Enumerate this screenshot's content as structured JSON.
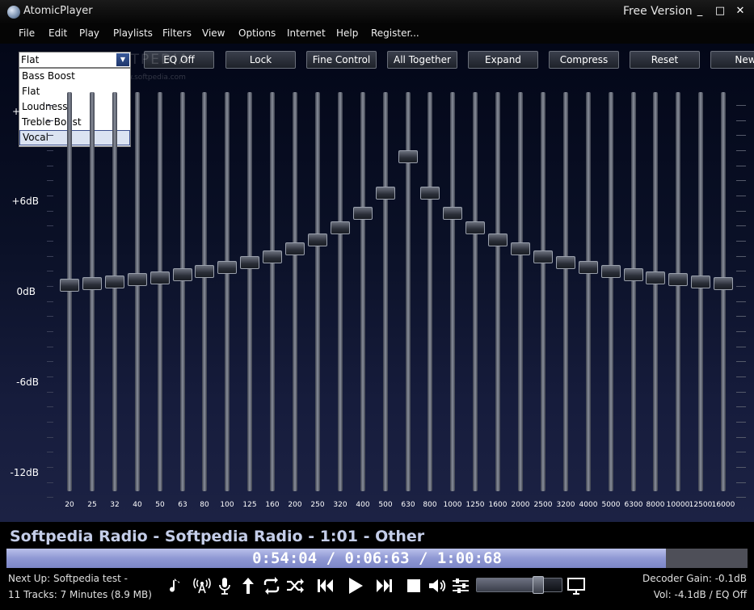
{
  "window": {
    "title": "AtomicPlayer",
    "version_label": "Free Version",
    "controls": {
      "minimize": "_",
      "maximize": "□",
      "close": "✕"
    }
  },
  "menu": [
    "File",
    "Edit",
    "Play",
    "Playlists",
    "Filters",
    "View",
    "Options",
    "Internet",
    "Help",
    "Register..."
  ],
  "equalizer": {
    "preset": {
      "selected": "Flat",
      "options": [
        "Bass Boost",
        "Flat",
        "Loudness",
        "Treble Boost",
        "Vocal"
      ],
      "highlighted_index": 4
    },
    "buttons": [
      "EQ Off",
      "Lock",
      "Fine Control",
      "All Together",
      "Expand",
      "Compress",
      "Reset",
      "New"
    ],
    "db_labels": [
      "+6dB",
      "0dB",
      "-6dB",
      "-12dB"
    ],
    "plus_marker": "+",
    "watermark": "SOFTPEDIA",
    "watermark_sub": "www.softpedia.com",
    "bands": [
      {
        "freq": "20",
        "gain_db": 0.1
      },
      {
        "freq": "25",
        "gain_db": 0.2
      },
      {
        "freq": "32",
        "gain_db": 0.3
      },
      {
        "freq": "40",
        "gain_db": 0.5
      },
      {
        "freq": "50",
        "gain_db": 0.6
      },
      {
        "freq": "63",
        "gain_db": 0.8
      },
      {
        "freq": "80",
        "gain_db": 1.0
      },
      {
        "freq": "100",
        "gain_db": 1.3
      },
      {
        "freq": "125",
        "gain_db": 1.6
      },
      {
        "freq": "160",
        "gain_db": 2.0
      },
      {
        "freq": "200",
        "gain_db": 2.5
      },
      {
        "freq": "250",
        "gain_db": 3.1
      },
      {
        "freq": "320",
        "gain_db": 3.9
      },
      {
        "freq": "400",
        "gain_db": 4.9
      },
      {
        "freq": "500",
        "gain_db": 6.2
      },
      {
        "freq": "630",
        "gain_db": 8.6
      },
      {
        "freq": "800",
        "gain_db": 6.2
      },
      {
        "freq": "1000",
        "gain_db": 4.9
      },
      {
        "freq": "1250",
        "gain_db": 3.9
      },
      {
        "freq": "1600",
        "gain_db": 3.1
      },
      {
        "freq": "2000",
        "gain_db": 2.5
      },
      {
        "freq": "2500",
        "gain_db": 2.0
      },
      {
        "freq": "3200",
        "gain_db": 1.6
      },
      {
        "freq": "4000",
        "gain_db": 1.3
      },
      {
        "freq": "5000",
        "gain_db": 1.0
      },
      {
        "freq": "6300",
        "gain_db": 0.8
      },
      {
        "freq": "8000",
        "gain_db": 0.6
      },
      {
        "freq": "10000",
        "gain_db": 0.5
      },
      {
        "freq": "12500",
        "gain_db": 0.3
      },
      {
        "freq": "16000",
        "gain_db": 0.2
      }
    ]
  },
  "player": {
    "now_playing": "Softpedia Radio - Softpedia Radio - 1:01 - Other",
    "time_display": "0:54:04 / 0:06:63 / 1:00:68",
    "progress": 0.89,
    "next_up": "Next Up: Softpedia test -",
    "track_count": "11 Tracks: 7 Minutes (8.9 MB)",
    "decoder_gain": "Decoder Gain: -0.1dB",
    "volume_readout": "Vol: -4.1dB / EQ Off",
    "volume_level": 0.72,
    "controls": [
      {
        "name": "music-note-icon"
      },
      {
        "name": "radio-tower-icon"
      },
      {
        "name": "microphone-icon"
      },
      {
        "name": "up-arrow-icon"
      },
      {
        "name": "repeat-icon"
      },
      {
        "name": "shuffle-icon"
      },
      {
        "name": "previous-track-icon"
      },
      {
        "name": "play-icon"
      },
      {
        "name": "next-track-icon"
      },
      {
        "name": "stop-icon"
      },
      {
        "name": "speaker-icon"
      },
      {
        "name": "equalizer-icon"
      },
      {
        "name": "monitor-icon"
      }
    ]
  }
}
